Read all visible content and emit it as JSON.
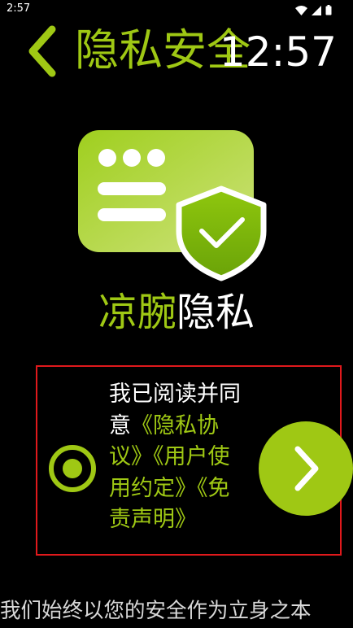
{
  "status_bar": {
    "time": "2:57",
    "icons": [
      "wifi-icon",
      "signal-icon",
      "battery-icon"
    ]
  },
  "header": {
    "back_icon": "chevron-left-icon",
    "title": "隐私安全",
    "clock": "12:57"
  },
  "illustration": {
    "icons": [
      "card-icon",
      "shield-check-icon"
    ]
  },
  "brand": {
    "accent": "凉腕",
    "rest": "隐私"
  },
  "consent": {
    "prefix": "我已阅读并同意",
    "privacy_link": "《隐私协议》",
    "terms_link": "《用户使用约定》",
    "disclaimer_link": "《免责声明》",
    "radio_icon": "radio-selected-icon",
    "next_icon": "chevron-right-icon"
  },
  "footer": {
    "slogan": "我们始终以您的安全作为立身之本"
  },
  "colors": {
    "accent": "#9fc814",
    "background": "#000000",
    "highlight_border": "#e0191c"
  }
}
